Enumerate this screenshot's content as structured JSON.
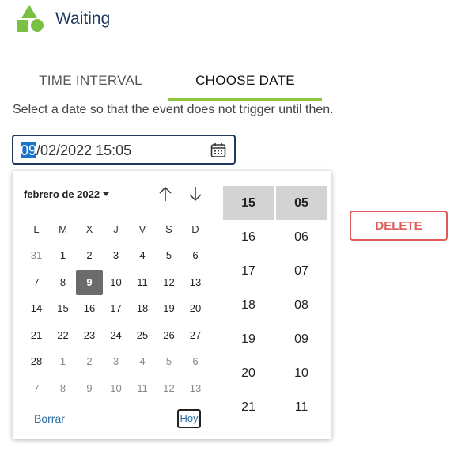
{
  "header": {
    "title": "Waiting",
    "logo_icon": "shapes-logo-icon",
    "accent_color": "#7ac143"
  },
  "tabs": [
    {
      "label": "TIME INTERVAL",
      "active": false
    },
    {
      "label": "CHOOSE DATE",
      "active": true
    }
  ],
  "helper_text": "Select a date so that the event does not trigger until then.",
  "date_input": {
    "value_selected_part": "09",
    "value_rest": "/02/2022 15:05",
    "icon": "calendar-icon"
  },
  "delete_label": "DELETE",
  "picker": {
    "month_label": "febrero de 2022",
    "weekdays": [
      "L",
      "M",
      "X",
      "J",
      "V",
      "S",
      "D"
    ],
    "weeks": [
      [
        {
          "d": "31",
          "other": true
        },
        {
          "d": "1"
        },
        {
          "d": "2"
        },
        {
          "d": "3"
        },
        {
          "d": "4"
        },
        {
          "d": "5"
        },
        {
          "d": "6"
        }
      ],
      [
        {
          "d": "7"
        },
        {
          "d": "8"
        },
        {
          "d": "9",
          "selected": true
        },
        {
          "d": "10"
        },
        {
          "d": "11"
        },
        {
          "d": "12"
        },
        {
          "d": "13"
        }
      ],
      [
        {
          "d": "14"
        },
        {
          "d": "15"
        },
        {
          "d": "16"
        },
        {
          "d": "17"
        },
        {
          "d": "18"
        },
        {
          "d": "19"
        },
        {
          "d": "20"
        }
      ],
      [
        {
          "d": "21"
        },
        {
          "d": "22"
        },
        {
          "d": "23"
        },
        {
          "d": "24"
        },
        {
          "d": "25"
        },
        {
          "d": "26"
        },
        {
          "d": "27"
        }
      ],
      [
        {
          "d": "28"
        },
        {
          "d": "1",
          "other": true
        },
        {
          "d": "2",
          "other": true
        },
        {
          "d": "3",
          "other": true
        },
        {
          "d": "4",
          "other": true
        },
        {
          "d": "5",
          "other": true
        },
        {
          "d": "6",
          "other": true
        }
      ],
      [
        {
          "d": "7",
          "other": true
        },
        {
          "d": "8",
          "other": true
        },
        {
          "d": "9",
          "other": true
        },
        {
          "d": "10",
          "other": true
        },
        {
          "d": "11",
          "other": true
        },
        {
          "d": "12",
          "other": true
        },
        {
          "d": "13",
          "other": true
        }
      ]
    ],
    "clear_label": "Borrar",
    "today_label": "Hoy",
    "hours": [
      "15",
      "16",
      "17",
      "18",
      "19",
      "20",
      "21"
    ],
    "minutes": [
      "05",
      "06",
      "07",
      "08",
      "09",
      "10",
      "11"
    ],
    "selected_hour": "15",
    "selected_minute": "05"
  }
}
